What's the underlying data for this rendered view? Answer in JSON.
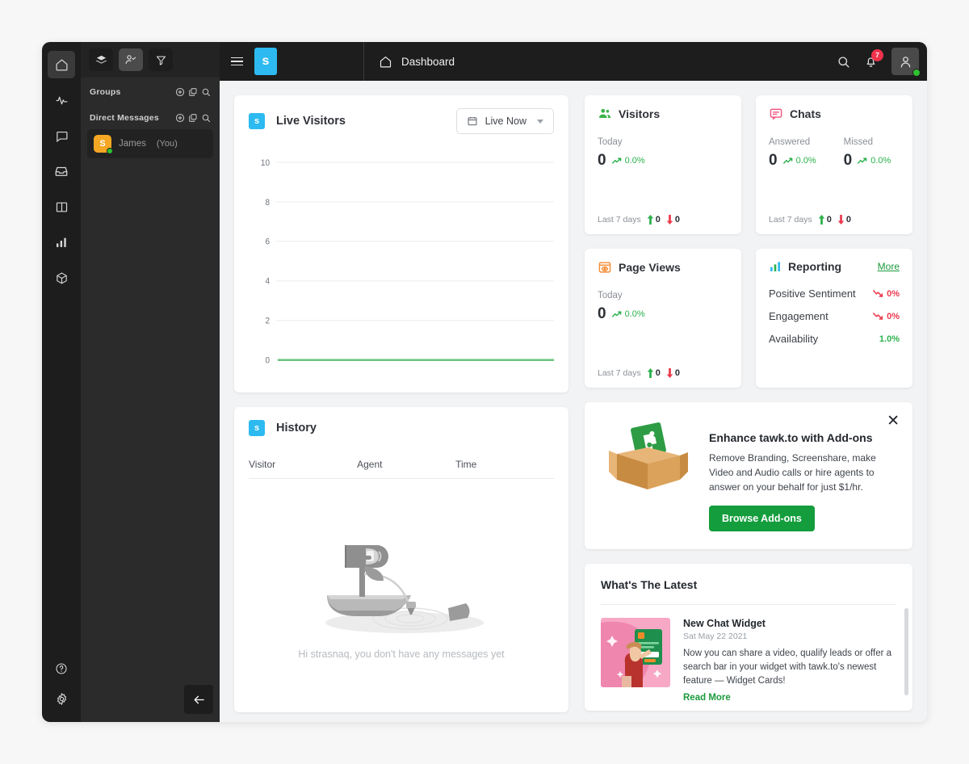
{
  "rail": {
    "items": [
      {
        "name": "home",
        "icon": "home-icon",
        "active": true
      },
      {
        "name": "monitoring",
        "icon": "pulse-icon",
        "active": false
      },
      {
        "name": "chat",
        "icon": "chat-bubble-icon",
        "active": false
      },
      {
        "name": "inbox",
        "icon": "inbox-icon",
        "active": false
      },
      {
        "name": "knowledge-base",
        "icon": "book-icon",
        "active": false
      },
      {
        "name": "reports",
        "icon": "bar-chart-icon",
        "active": false
      },
      {
        "name": "apps",
        "icon": "box-icon",
        "active": false
      }
    ],
    "bottom": [
      {
        "name": "help",
        "icon": "help-circle-icon"
      },
      {
        "name": "settings",
        "icon": "gear-icon"
      }
    ]
  },
  "panel": {
    "tabs": [
      {
        "name": "layers",
        "icon": "layers-icon",
        "active": false
      },
      {
        "name": "contacts",
        "icon": "person-check-icon",
        "active": true
      },
      {
        "name": "filter",
        "icon": "funnel-icon",
        "active": false
      }
    ],
    "section_actions": [
      "add-circle-icon",
      "copy-icon",
      "search-icon"
    ],
    "groups": {
      "label": "Groups"
    },
    "direct_messages": {
      "label": "Direct Messages",
      "items": [
        {
          "initial": "S",
          "name": "James",
          "suffix": "(You)",
          "status": "online",
          "avatar_color": "#f5a623"
        }
      ]
    },
    "collapse_label": "←"
  },
  "topbar": {
    "logo_letter": "s",
    "page_icon": "home-icon",
    "page_title": "Dashboard",
    "search_icon": "search-icon",
    "bell_icon": "bell-icon",
    "notification_count": "7",
    "avatar_icon": "user-avatar-icon",
    "status": "online"
  },
  "live_visitors": {
    "badge": "s",
    "title": "Live Visitors",
    "range_icon": "calendar-icon",
    "range_label": "Live Now"
  },
  "chart_data": {
    "type": "line",
    "title": "Live Visitors",
    "series": [
      {
        "name": "Live Visitors",
        "values": [
          0,
          0,
          0,
          0,
          0,
          0,
          0,
          0,
          0,
          0,
          0,
          0
        ],
        "color": "#6ac47e"
      }
    ],
    "x": [
      "",
      "",
      "",
      "",
      "",
      "",
      "",
      "",
      "",
      "",
      "",
      ""
    ],
    "xlabel": "",
    "ylabel": "",
    "yticks": [
      0,
      2,
      4,
      6,
      8,
      10
    ],
    "ylim": [
      0,
      10
    ],
    "grid": true,
    "legend": "none"
  },
  "visitors_card": {
    "icon": "visitors-group-icon",
    "icon_color": "#3cb44a",
    "title": "Visitors",
    "metrics": [
      {
        "label": "Today",
        "value": "0",
        "delta": "0.0%",
        "trend": "up"
      }
    ],
    "footer_label": "Last 7 days",
    "footer_up": "0",
    "footer_down": "0"
  },
  "chats_card": {
    "icon": "chat-square-icon",
    "icon_color": "#f2557f",
    "title": "Chats",
    "metrics": [
      {
        "label": "Answered",
        "value": "0",
        "delta": "0.0%",
        "trend": "up"
      },
      {
        "label": "Missed",
        "value": "0",
        "delta": "0.0%",
        "trend": "up"
      }
    ],
    "footer_label": "Last 7 days",
    "footer_up": "0",
    "footer_down": "0"
  },
  "page_views_card": {
    "icon": "page-views-icon",
    "icon_color": "#f58c34",
    "title": "Page Views",
    "metrics": [
      {
        "label": "Today",
        "value": "0",
        "delta": "0.0%",
        "trend": "up"
      }
    ],
    "footer_label": "Last 7 days",
    "footer_up": "0",
    "footer_down": "0"
  },
  "reporting_card": {
    "icon": "bar-chart-icon",
    "title": "Reporting",
    "more_label": "More",
    "rows": [
      {
        "name": "Positive Sentiment",
        "value": "0%",
        "trend": "down"
      },
      {
        "name": "Engagement",
        "value": "0%",
        "trend": "down"
      },
      {
        "name": "Availability",
        "value": "1.0%",
        "trend": "flat"
      }
    ]
  },
  "history_card": {
    "badge": "s",
    "title": "History",
    "columns": [
      "Visitor",
      "Agent",
      "Time"
    ],
    "empty_text": "Hi strasnaq, you don't have any messages yet",
    "empty_illustration": "mailbox-boat-illustration"
  },
  "promo_card": {
    "close_icon": "close-icon",
    "illustration": "open-box-puzzle-illustration",
    "title": "Enhance tawk.to with Add-ons",
    "text": "Remove Branding, Screenshare, make Video and Audio calls or hire agents to answer on your behalf for just $1/hr.",
    "button_label": "Browse Add-ons",
    "button_color": "#149d3c"
  },
  "latest_card": {
    "title": "What's The Latest",
    "items": [
      {
        "thumb": "chat-widget-illustration",
        "headline": "New Chat Widget",
        "date": "Sat May 22 2021",
        "body": "Now you can share a video, qualify leads or offer a search bar in your widget with tawk.to's newest feature — Widget Cards!",
        "read_more": "Read More"
      }
    ]
  }
}
